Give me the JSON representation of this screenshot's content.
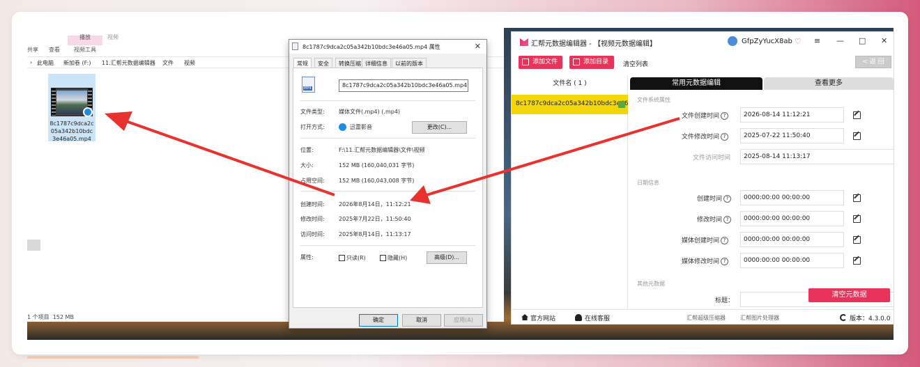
{
  "explorer": {
    "ribbon": {
      "share": "共享",
      "view": "查看",
      "play_tab": "播放",
      "video_tools": "视频工具",
      "video": "视频"
    },
    "breadcrumb": [
      "此电脑",
      "新加卷 (F:)",
      "11.汇帮元数据编辑器",
      "文件",
      "视频"
    ],
    "file": {
      "name": "8c1787c9dca2c05a342b10bdc3e46a05.mp4"
    },
    "status": {
      "items": "1 个项目",
      "size": "152 MB"
    }
  },
  "props": {
    "title": "8c1787c9dca2c05a342b10bdc3e46a05.mp4 属性",
    "tabs": [
      "常规",
      "安全",
      "转换压缩",
      "详细信息",
      "以前的版本"
    ],
    "file_name": "8c1787c9dca2c05a342b10bdc3e46a05.mp4",
    "icon_label": "MP4",
    "type_label": "文件类型:",
    "type_value": "媒体文件(.mp4) (.mp4)",
    "open_label": "打开方式:",
    "open_value": "迅雷影音",
    "change_btn": "更改(C)...",
    "loc_label": "位置:",
    "loc_value": "F:\\11.汇帮元数据编辑器\\文件\\视频",
    "size_label": "大小:",
    "size_value": "152 MB (160,040,031 字节)",
    "disk_label": "占用空间:",
    "disk_value": "152 MB (160,043,008 字节)",
    "created_label": "创建时间:",
    "created_value": "2026年8月14日，11:12:21",
    "modified_label": "修改时间:",
    "modified_value": "2025年7月22日，11:50:40",
    "accessed_label": "访问时间:",
    "accessed_value": "2025年8月14日，11:13:17",
    "attr_label": "属性:",
    "readonly": "只读(R)",
    "hidden": "隐藏(H)",
    "advanced_btn": "高级(D)...",
    "ok": "确定",
    "cancel": "取消",
    "apply": "应用(A)"
  },
  "editor": {
    "title": "汇帮元数据编辑器 - 【视频元数据编辑】",
    "user": "GfpZyYucX8ab",
    "add_file": "添加文件",
    "add_dir": "添加目录",
    "clear_list": "清空列表",
    "back": "< 返 回",
    "col_filename": "文件名 ( 1 )",
    "file_row": "8c1787c9dca2c05a342b10bdc3e46a05.mp4",
    "tab_common": "常用元数据编辑",
    "tab_more": "查看更多",
    "sec_fs": "文件系统属性",
    "f_created": "文件创建时间",
    "v_created": "2026-08-14 11:12:21",
    "f_modified": "文件修改时间",
    "v_modified": "2025-07-22 11:50:40",
    "f_accessed": "文件访问时间",
    "v_accessed": "2025-08-14 11:13:17",
    "sec_date": "日期信息",
    "d_created": "创建时间",
    "d_modified": "修改时间",
    "d_media_created": "媒体创建时间",
    "d_media_modified": "媒体修改时间",
    "date_default": "0000:00:00 00:00:00",
    "sec_other": "其他元数据",
    "o_title": "标题：",
    "clear_meta": "清空元数据",
    "footer": {
      "site": "官方网站",
      "service": "在线客服",
      "compress": "汇帮超级压缩器",
      "image": "汇帮图片处理器",
      "version": "版本：4.3.0.0"
    }
  }
}
